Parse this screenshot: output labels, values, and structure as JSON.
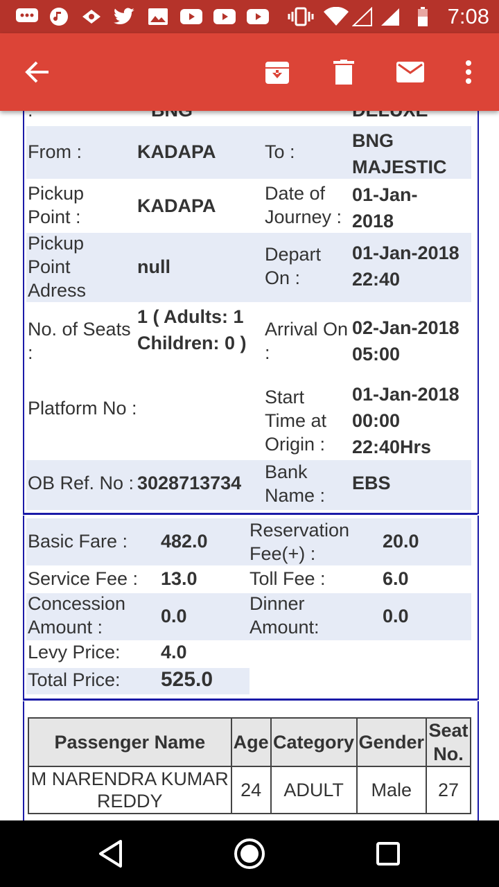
{
  "status_bar": {
    "time": "7:08",
    "icons": [
      "chat-icon",
      "music-icon",
      "cloud-icon",
      "twitter-icon",
      "photo-icon",
      "youtube-icon",
      "youtube-icon",
      "youtube-icon",
      "vibrate-icon",
      "wifi-icon",
      "signal-icon",
      "signal-icon",
      "battery-icon"
    ]
  },
  "app_bar": {
    "back": "back-arrow-icon",
    "actions": [
      "archive-icon",
      "delete-icon",
      "mail-icon",
      "more-icon"
    ]
  },
  "journey": {
    "cut_top_left": ":",
    "cut_top_val": "BNG",
    "cut_top_right": "DELUXE",
    "from_label": "From :",
    "from_value": "KADAPA",
    "to_label": "To :",
    "to_value": "BNG MAJESTIC",
    "pickup_label": "Pickup Point :",
    "pickup_value": "KADAPA",
    "doj_label": "Date of Journey :",
    "doj_value": "01-Jan-2018",
    "pickup_addr_label": "Pickup Point Adress",
    "pickup_addr_value": "null",
    "depart_label": "Depart On :",
    "depart_value": "01-Jan-2018 22:40",
    "seats_label": "No. of Seats :",
    "seats_value": "1 ( Adults: 1 Children: 0 )",
    "arrival_label": "Arrival On :",
    "arrival_value": "02-Jan-2018 05:00",
    "platform_label": "Platform No :",
    "platform_value": "",
    "start_label": "Start Time at Origin :",
    "start_value": "01-Jan-2018 00:00 22:40Hrs",
    "obref_label": "OB Ref. No :",
    "obref_value": "3028713734",
    "bank_label": "Bank Name :",
    "bank_value": "EBS"
  },
  "fare": {
    "basic_label": "Basic Fare :",
    "basic_value": "482.0",
    "reservation_label": "Reservation Fee(+) :",
    "reservation_value": "20.0",
    "service_label": "Service Fee :",
    "service_value": "13.0",
    "toll_label": "Toll Fee :",
    "toll_value": "6.0",
    "concession_label": "Concession Amount :",
    "concession_value": "0.0",
    "dinner_label": "Dinner Amount:",
    "dinner_value": "0.0",
    "levy_label": "Levy Price:",
    "levy_value": "4.0",
    "total_label": "Total Price:",
    "total_value": "525.0"
  },
  "passengers": {
    "headers": [
      "Passenger Name",
      "Age",
      "Category",
      "Gender",
      "Seat No."
    ],
    "rows": [
      [
        "M NARENDRA KUMAR REDDY",
        "24",
        "ADULT",
        "Male",
        "27"
      ]
    ]
  },
  "nav_bar": [
    "back-triangle-icon",
    "home-circle-icon",
    "recents-square-icon"
  ]
}
